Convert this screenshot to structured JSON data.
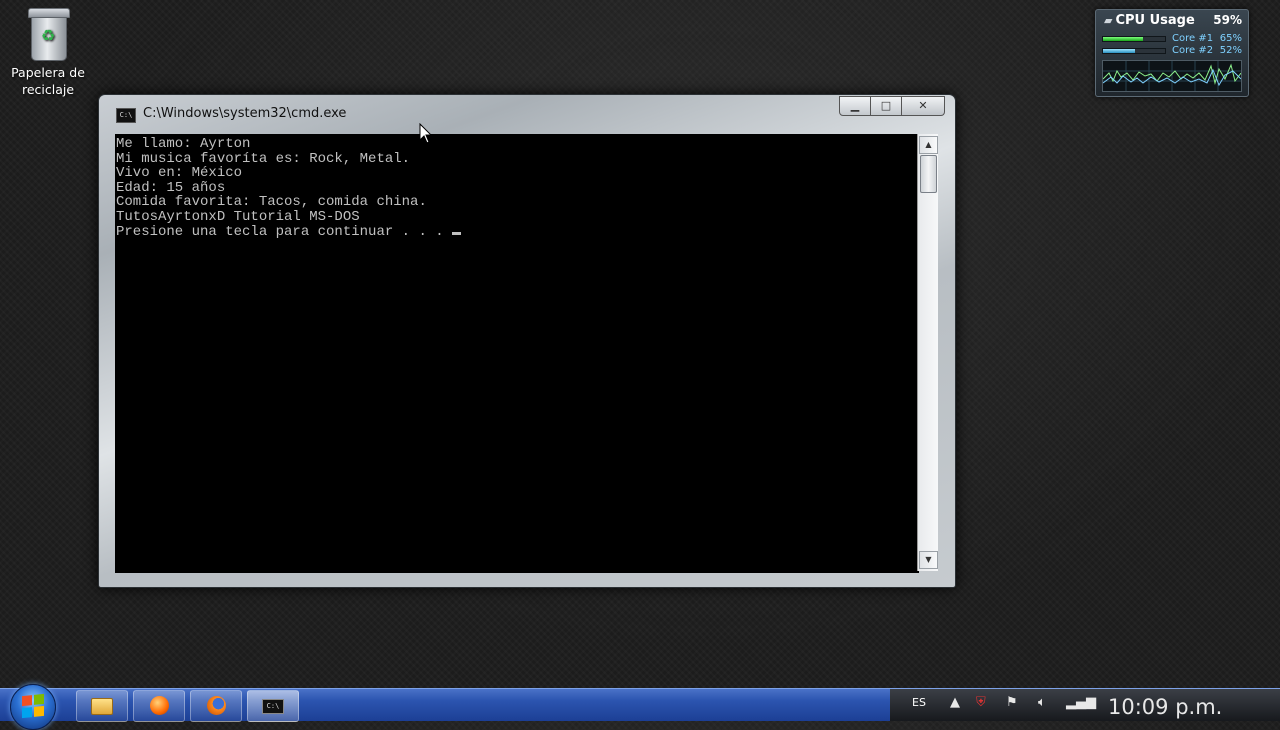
{
  "desktop": {
    "recycle_bin_label_line1": "Papelera de",
    "recycle_bin_label_line2": "reciclaje"
  },
  "cpu_gadget": {
    "title": "CPU Usage",
    "total": "59%",
    "cores": [
      {
        "label": "Core #1",
        "percent": "65%",
        "fraction": 0.65
      },
      {
        "label": "Core #2",
        "percent": "52%",
        "fraction": 0.52
      }
    ]
  },
  "cmd_window": {
    "title": "C:\\Windows\\system32\\cmd.exe",
    "console_lines": [
      "Me llamo: Ayrton",
      "Mi musica favoríta es: Rock, Metal.",
      "Vivo en: México",
      "Edad: 15 años",
      "Comida favorita: Tacos, comida china.",
      "TutosAyrtonxD Tutorial MS-DOS",
      "Presione una tecla para continuar . . . "
    ],
    "buttons": {
      "minimize": "▁",
      "maximize": "□",
      "close": "✕"
    }
  },
  "taskbar": {
    "items": [
      {
        "name": "explorer",
        "icon": "folder-icon"
      },
      {
        "name": "media-player",
        "icon": "media-player-icon"
      },
      {
        "name": "firefox",
        "icon": "firefox-icon"
      },
      {
        "name": "cmd",
        "icon": "cmd-icon",
        "label": "C:\\"
      }
    ],
    "language": "ES",
    "clock": "10:09 p.m."
  }
}
